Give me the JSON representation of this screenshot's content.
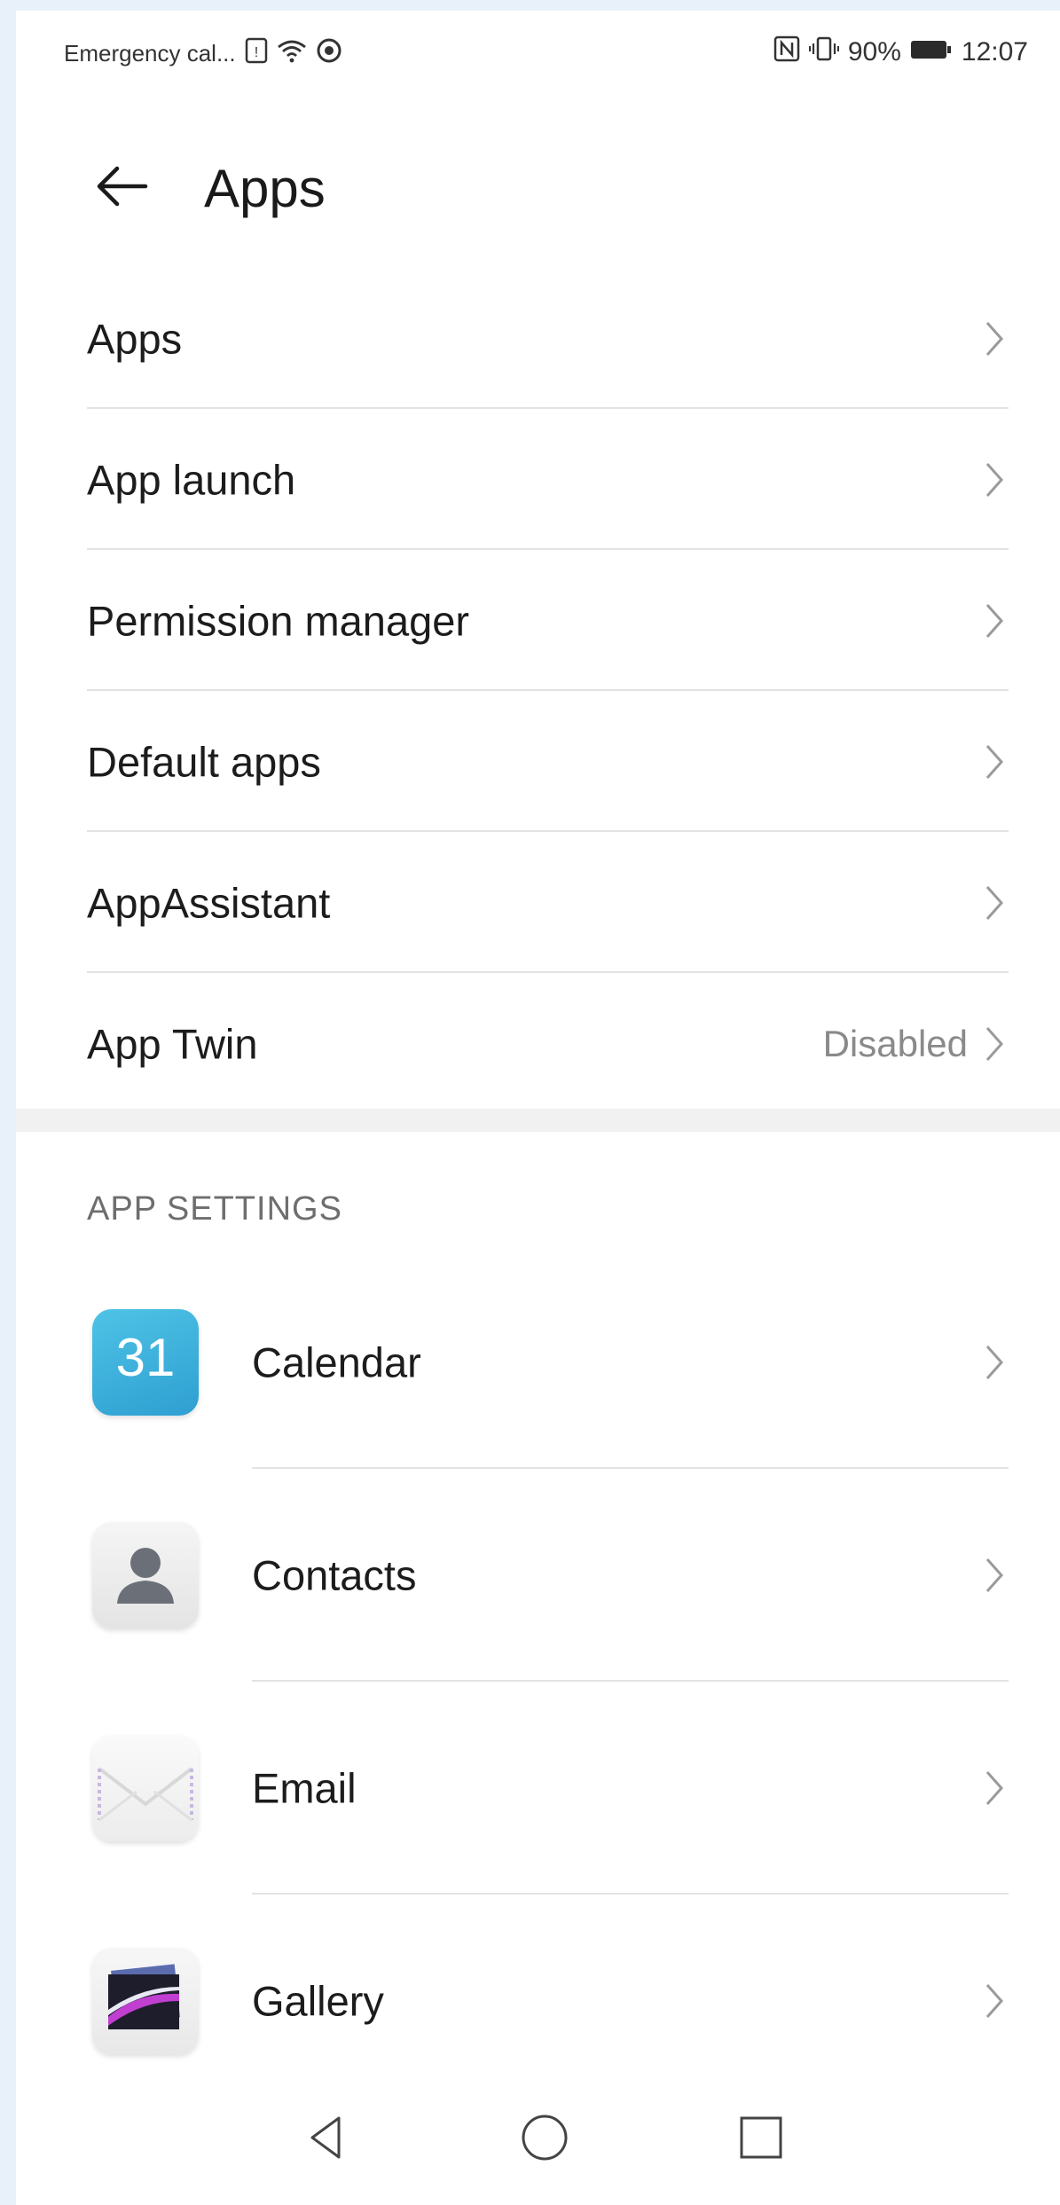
{
  "status_bar": {
    "carrier_text": "Emergency cal...",
    "battery_percent": "90%",
    "time": "12:07",
    "icons_left": [
      "sim-icon",
      "wifi-icon",
      "data-saver-icon"
    ],
    "icons_right": [
      "nfc-icon",
      "vibrate-icon",
      "battery-icon"
    ]
  },
  "header": {
    "back_icon": "arrow-left-icon",
    "title": "Apps"
  },
  "menu": [
    {
      "label": "Apps",
      "value": ""
    },
    {
      "label": "App launch",
      "value": ""
    },
    {
      "label": "Permission manager",
      "value": ""
    },
    {
      "label": "Default apps",
      "value": ""
    },
    {
      "label": "AppAssistant",
      "value": ""
    },
    {
      "label": "App Twin",
      "value": "Disabled"
    }
  ],
  "app_settings": {
    "section_title": "APP SETTINGS",
    "apps": [
      {
        "label": "Calendar",
        "icon": "calendar-icon",
        "icon_text": "31"
      },
      {
        "label": "Contacts",
        "icon": "contacts-icon"
      },
      {
        "label": "Email",
        "icon": "email-icon"
      },
      {
        "label": "Gallery",
        "icon": "gallery-icon"
      }
    ]
  },
  "nav_bar": {
    "icons": [
      "back-triangle-icon",
      "home-circle-icon",
      "recents-square-icon"
    ]
  },
  "colors": {
    "background": "#ffffff",
    "frame": "#e8f0fa",
    "divider": "#e3e3e3",
    "secondary_text": "#8a8a8a",
    "calendar_blue": "#3aaedb"
  }
}
